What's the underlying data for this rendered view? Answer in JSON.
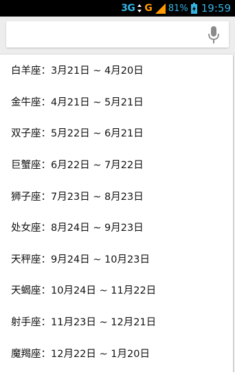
{
  "status_bar": {
    "network_3g": "3G",
    "network_g": "G",
    "battery_percent": "81%",
    "time": "19:59"
  },
  "search": {
    "placeholder": "",
    "mic_icon": "microphone-icon"
  },
  "zodiac_list": [
    {
      "label": "白羊座：3月21日 ~ 4月20日"
    },
    {
      "label": "金牛座：4月21日 ~ 5月21日"
    },
    {
      "label": "双子座：5月22日 ~ 6月21日"
    },
    {
      "label": "巨蟹座：6月22日 ~ 7月22日"
    },
    {
      "label": "狮子座：7月23日 ~ 8月23日"
    },
    {
      "label": "处女座：8月24日 ~ 9月23日"
    },
    {
      "label": "天秤座：9月24日 ~ 10月23日"
    },
    {
      "label": "天蝎座：10月24日 ~ 11月22日"
    },
    {
      "label": "射手座：11月23日 ~ 12月21日"
    },
    {
      "label": "魔羯座：12月22日 ~ 1月20日"
    }
  ],
  "colors": {
    "status_accent": "#33b5e5",
    "signal_g": "#ff9900",
    "search_bg": "#ededed"
  }
}
